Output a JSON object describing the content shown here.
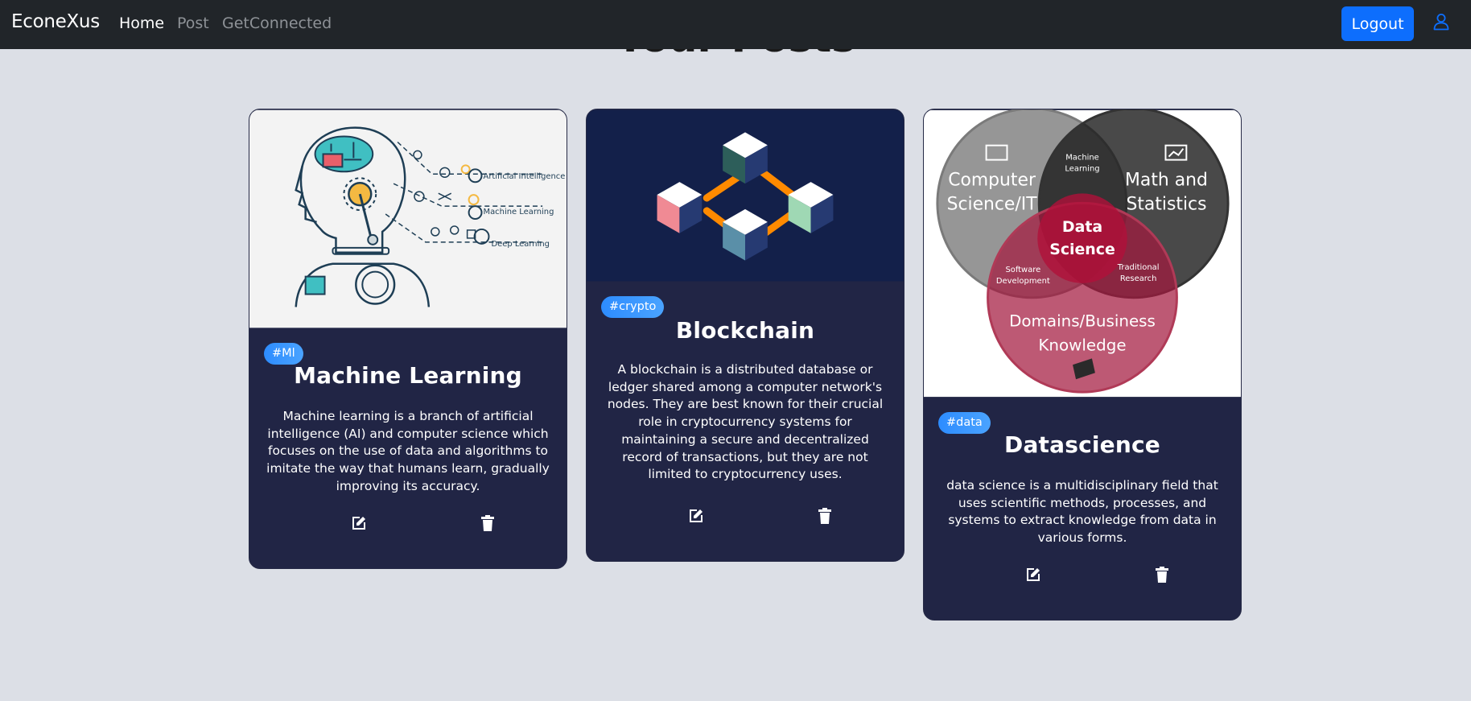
{
  "nav": {
    "brand": "EconeXus",
    "links": [
      "Home",
      "Post",
      "GetConnected"
    ],
    "logout_label": "Logout",
    "accent": "#0d6efd"
  },
  "page": {
    "title": "Your Posts"
  },
  "cards": [
    {
      "tag": "#Ml",
      "title": "Machine Learning",
      "text": "Machine learning is a branch of artificial intelligence (AI) and computer science which focuses on the use of data and algorithms to imitate the way that humans learn, gradually improving its accuracy.",
      "image": {
        "label_1": "Artificial Intelligence",
        "label_2": "Machine Learning",
        "label_3": "Deep Learning"
      }
    },
    {
      "tag": "#crypto",
      "title": "Blockchain",
      "text": "A blockchain is a distributed database or ledger shared among a computer network's nodes. They are best known for their crucial role in cryptocurrency systems for maintaining a secure and decentralized record of transactions, but they are not limited to cryptocurrency uses."
    },
    {
      "tag": "#data",
      "title": "Datascience",
      "text": "data science is a multidisciplinary field that uses scientific methods, processes, and systems to extract knowledge from data in various forms.",
      "image": {
        "cs_1": "Computer",
        "cs_2": "Science/IT",
        "ms_1": "Math and",
        "ms_2": "Statistics",
        "dom_1": "Domains/Business",
        "dom_2": "Knowledge",
        "ml_1": "Machine",
        "ml_2": "Learning",
        "ds_1": "Data",
        "ds_2": "Science",
        "sd_1": "Software",
        "sd_2": "Development",
        "tr_1": "Traditional",
        "tr_2": "Research"
      }
    }
  ]
}
